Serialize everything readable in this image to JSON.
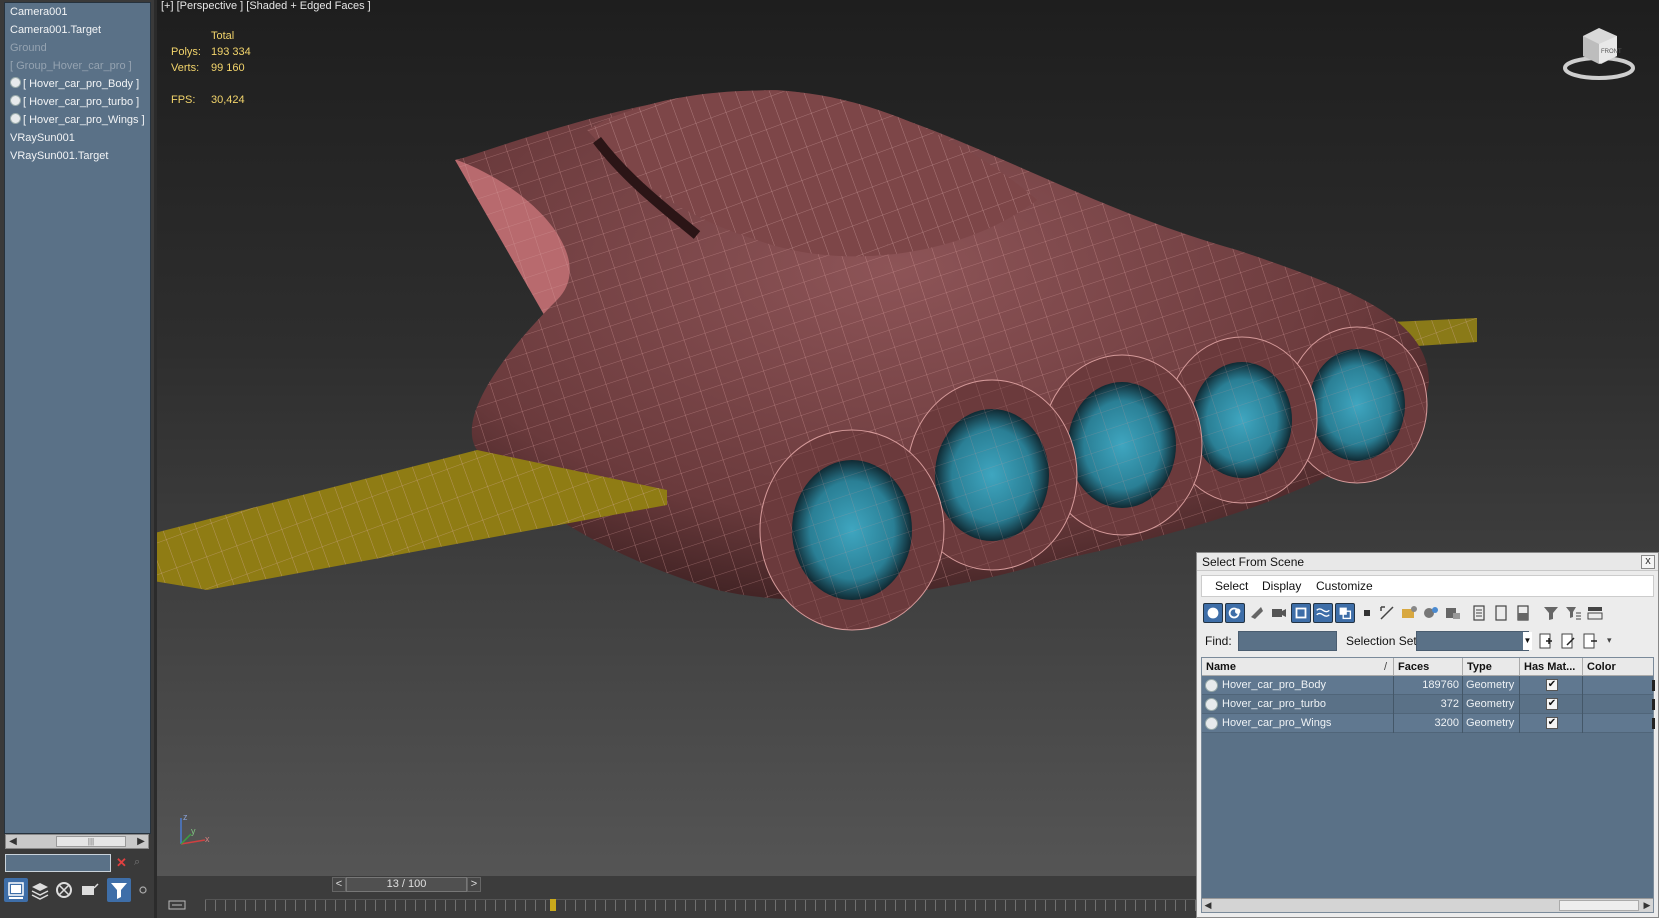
{
  "explorer": {
    "items": [
      {
        "label": "Camera001",
        "icon": "none",
        "dim": false
      },
      {
        "label": "Camera001.Target",
        "icon": "none",
        "dim": false
      },
      {
        "label": "Ground",
        "icon": "none",
        "dim": true
      },
      {
        "label": "[ Group_Hover_car_pro ]",
        "icon": "none",
        "dim": true
      },
      {
        "label": "[ Hover_car_pro_Body ]",
        "icon": "sphere-icon",
        "dim": false
      },
      {
        "label": "[ Hover_car_pro_turbo ]",
        "icon": "sphere-icon",
        "dim": false
      },
      {
        "label": "[ Hover_car_pro_Wings ]",
        "icon": "sphere-icon",
        "dim": false
      },
      {
        "label": "VRaySun001",
        "icon": "none",
        "dim": false
      },
      {
        "label": "VRaySun001.Target",
        "icon": "none",
        "dim": false
      }
    ],
    "search_value": "",
    "clear_glyph": "✕",
    "toolbar_icons": [
      "select-objects-icon",
      "layers-icon",
      "display-icon",
      "sort-icon",
      "filter-icon"
    ]
  },
  "viewport": {
    "label": "[+] [Perspective ] [Shaded + Edged Faces ]",
    "stats_header": "Total",
    "polys_label": "Polys:",
    "polys_value": "193 334",
    "verts_label": "Verts:",
    "verts_value": "99 160",
    "fps_label": "FPS:",
    "fps_value": "30,424",
    "viewcube_label": "FRONT",
    "axis": {
      "z": "z",
      "x": "x",
      "y": "y"
    },
    "colors": {
      "stats": "#f2d46b",
      "model": "#7a4446",
      "wireframe": "#d59a9a",
      "wings": "#a08a1c",
      "fans": "#3fa6c0"
    }
  },
  "timeline": {
    "frame_label": "13 / 100",
    "prev": "<",
    "next": ">",
    "current_frame_fraction": 0.13
  },
  "dialog": {
    "title": "Select From Scene",
    "close": "x",
    "menu": [
      "Select",
      "Display",
      "Customize"
    ],
    "find_label": "Find:",
    "find_value": "",
    "selection_set_label": "Selection Set:",
    "selection_set_value": "",
    "columns": [
      "Name",
      "Faces",
      "Type",
      "Has Mat...",
      "Color"
    ],
    "rows": [
      {
        "name": "Hover_car_pro_Body",
        "faces": "189760",
        "type": "Geometry",
        "has_material": true
      },
      {
        "name": "Hover_car_pro_turbo",
        "faces": "372",
        "type": "Geometry",
        "has_material": true
      },
      {
        "name": "Hover_car_pro_Wings",
        "faces": "3200",
        "type": "Geometry",
        "has_material": true
      }
    ],
    "check_glyph": "✔",
    "sort_glyph": "/"
  }
}
